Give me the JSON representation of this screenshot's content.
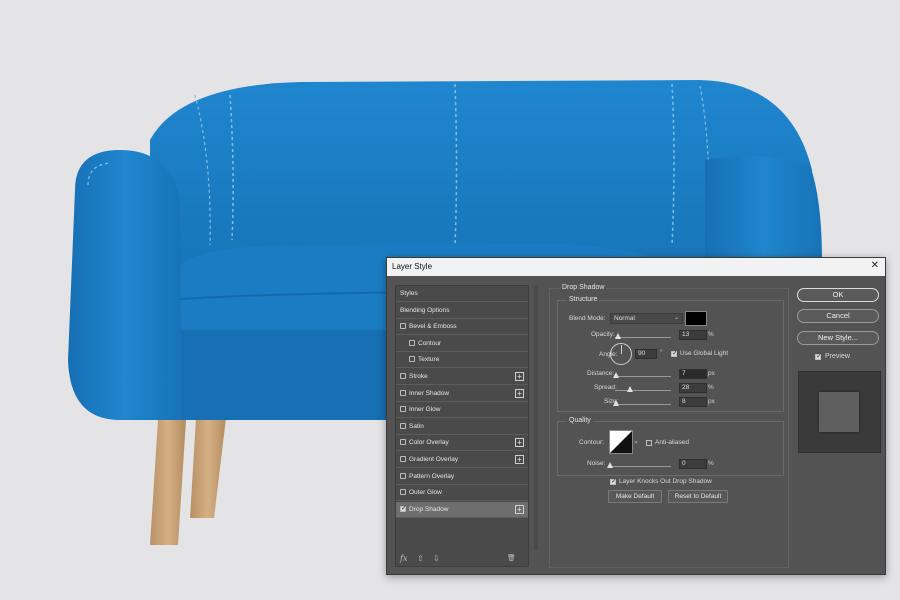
{
  "dialog": {
    "title": "Layer Style",
    "close": "✕",
    "styles_list": [
      {
        "label": "Styles",
        "checkbox": false,
        "checked": false,
        "plus": false,
        "indent": 0
      },
      {
        "label": "Blending Options",
        "checkbox": false,
        "checked": false,
        "plus": false,
        "indent": 0
      },
      {
        "label": "Bevel & Emboss",
        "checkbox": true,
        "checked": false,
        "plus": false,
        "indent": 0
      },
      {
        "label": "Contour",
        "checkbox": true,
        "checked": false,
        "plus": false,
        "indent": 1
      },
      {
        "label": "Texture",
        "checkbox": true,
        "checked": false,
        "plus": false,
        "indent": 1
      },
      {
        "label": "Stroke",
        "checkbox": true,
        "checked": false,
        "plus": true,
        "indent": 0
      },
      {
        "label": "Inner Shadow",
        "checkbox": true,
        "checked": false,
        "plus": true,
        "indent": 0
      },
      {
        "label": "Inner Glow",
        "checkbox": true,
        "checked": false,
        "plus": false,
        "indent": 0
      },
      {
        "label": "Satin",
        "checkbox": true,
        "checked": false,
        "plus": false,
        "indent": 0
      },
      {
        "label": "Color Overlay",
        "checkbox": true,
        "checked": false,
        "plus": true,
        "indent": 0
      },
      {
        "label": "Gradient Overlay",
        "checkbox": true,
        "checked": false,
        "plus": true,
        "indent": 0
      },
      {
        "label": "Pattern Overlay",
        "checkbox": true,
        "checked": false,
        "plus": false,
        "indent": 0
      },
      {
        "label": "Outer Glow",
        "checkbox": true,
        "checked": false,
        "plus": false,
        "indent": 0
      },
      {
        "label": "Drop Shadow",
        "checkbox": true,
        "checked": true,
        "plus": true,
        "indent": 0,
        "selected": true
      }
    ],
    "list_footer": {
      "fx": "fx",
      "up": "⇧",
      "down": "⇩",
      "trash": "🗑"
    },
    "panel_title": "Drop Shadow",
    "structure": {
      "title": "Structure",
      "blend_mode_label": "Blend Mode:",
      "blend_mode": "Normal",
      "shadow_color": "#000000",
      "opacity_label": "Opacity:",
      "opacity": "13",
      "opacity_unit": "%",
      "angle_label": "Angle:",
      "angle": "90",
      "angle_unit": "°",
      "use_global_light": "Use Global Light",
      "distance_label": "Distance:",
      "distance": "7",
      "distance_unit": "px",
      "spread_label": "Spread:",
      "spread": "28",
      "spread_unit": "%",
      "size_label": "Size:",
      "size": "8",
      "size_unit": "px"
    },
    "quality": {
      "title": "Quality",
      "contour_label": "Contour:",
      "anti_aliased": "Anti-aliased",
      "noise_label": "Noise:",
      "noise": "0",
      "noise_unit": "%"
    },
    "knockout": "Layer Knocks Out Drop Shadow",
    "make_default": "Make Default",
    "reset_default": "Reset to Default",
    "ok": "OK",
    "cancel": "Cancel",
    "new_style": "New Style...",
    "preview": "Preview",
    "colors": {
      "sofa": "#1a7ac2",
      "legs": "#c9a477",
      "panel": "#535353"
    }
  }
}
